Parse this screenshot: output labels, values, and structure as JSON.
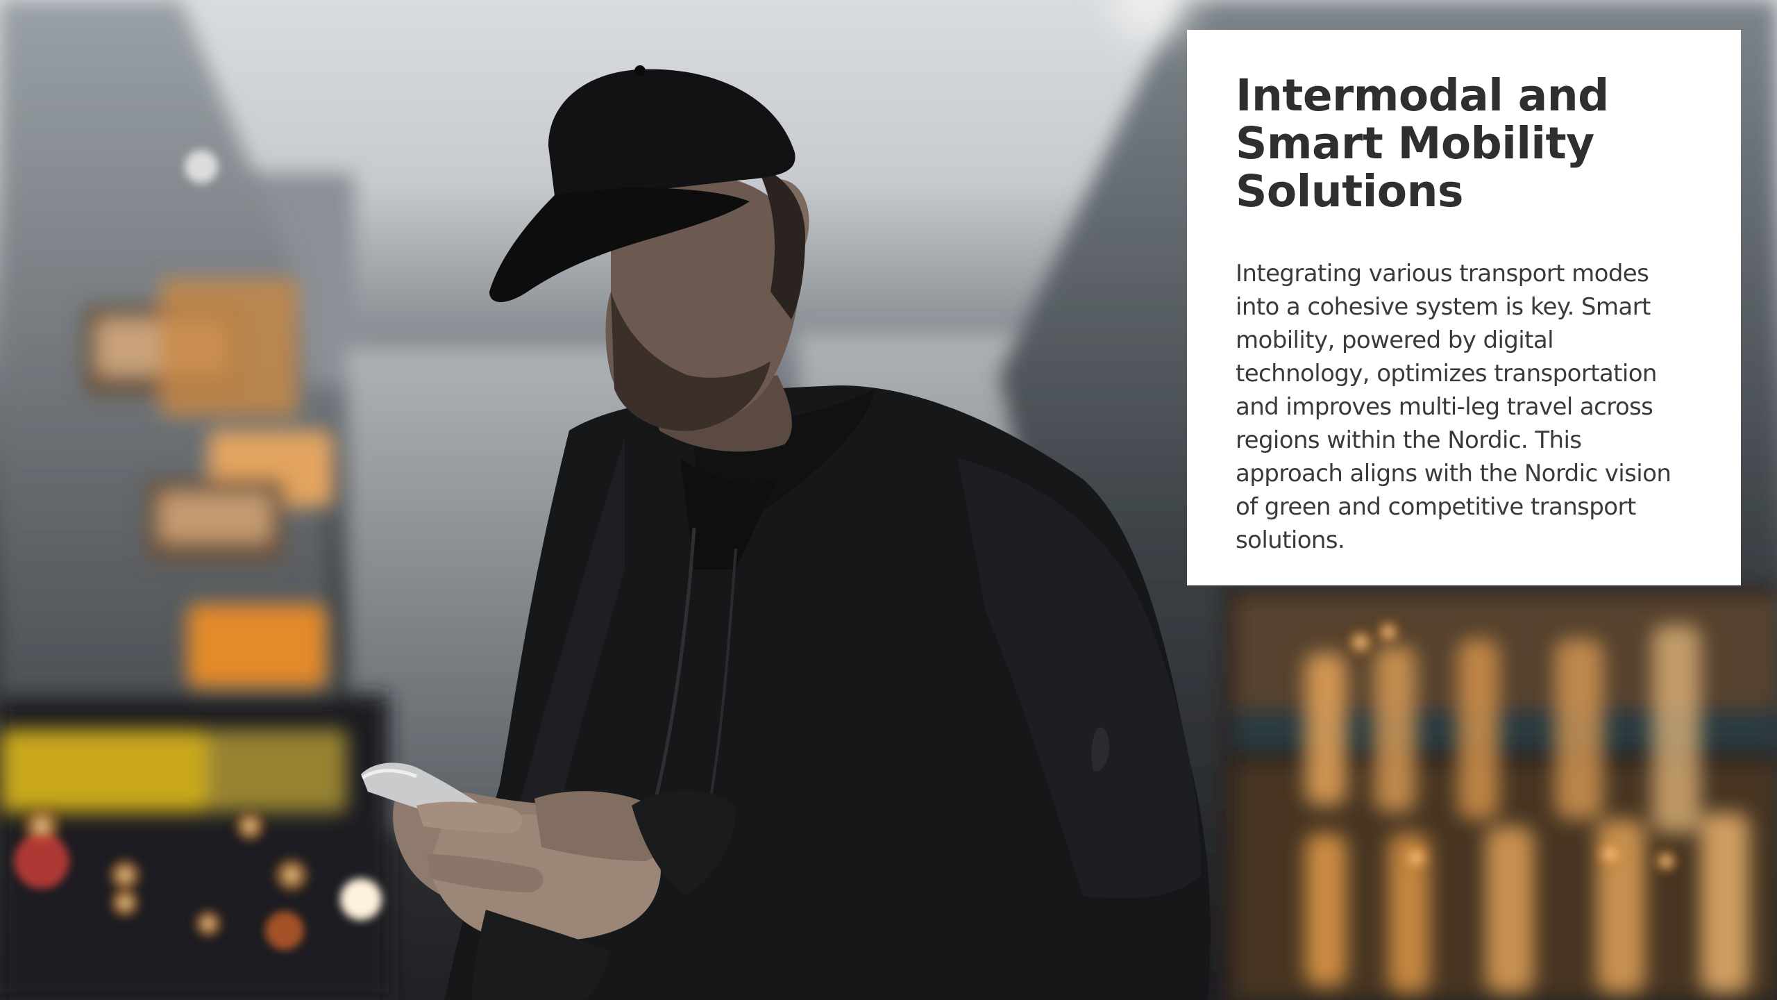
{
  "slide": {
    "title": "Intermodal and Smart Mobility Solutions",
    "body": "Integrating various transport modes into a cohesive system is key. Smart mobility, powered by digital technology, optimizes transportation and improves multi-leg travel across regions within the Nordic. This approach aligns with the Nordic vision of green and competitive transport solutions."
  },
  "background_photo": {
    "subject": "man in black cap and jacket looking at smartphone on blurred city street at dusk"
  },
  "colors": {
    "card_background": "#ffffff",
    "title_text": "#2f2f2f",
    "body_text": "#3a3a3a"
  }
}
